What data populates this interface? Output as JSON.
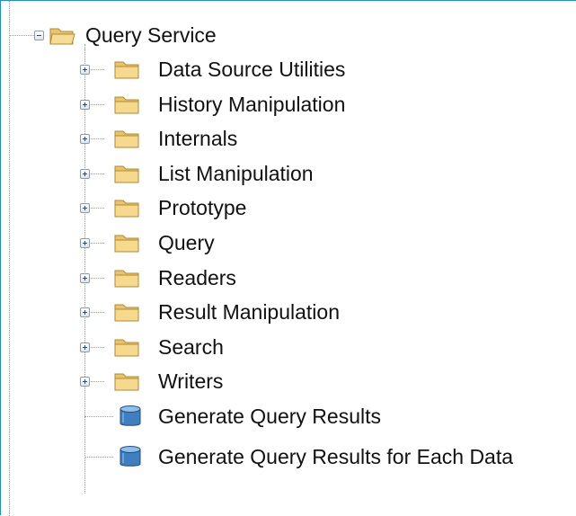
{
  "tree": {
    "root": {
      "label": "Query Service",
      "icon": "folder-open-icon",
      "expanded": true
    },
    "folders": [
      {
        "label": "Data Source Utilities",
        "icon": "folder-icon",
        "expanded": false
      },
      {
        "label": "History Manipulation",
        "icon": "folder-icon",
        "expanded": false
      },
      {
        "label": "Internals",
        "icon": "folder-icon",
        "expanded": false
      },
      {
        "label": "List Manipulation",
        "icon": "folder-icon",
        "expanded": false
      },
      {
        "label": "Prototype",
        "icon": "folder-icon",
        "expanded": false
      },
      {
        "label": "Query",
        "icon": "folder-icon",
        "expanded": false
      },
      {
        "label": "Readers",
        "icon": "folder-icon",
        "expanded": false
      },
      {
        "label": "Result Manipulation",
        "icon": "folder-icon",
        "expanded": false
      },
      {
        "label": "Search",
        "icon": "folder-icon",
        "expanded": false
      },
      {
        "label": "Writers",
        "icon": "folder-icon",
        "expanded": false
      }
    ],
    "items": [
      {
        "label": "Generate Query Results",
        "icon": "database-icon"
      },
      {
        "label": "Generate Query Results for Each Data",
        "icon": "database-icon"
      }
    ]
  },
  "colors": {
    "frame_border": "#1f8fd0",
    "folder_fill": "#f3d488",
    "folder_edge": "#b08a2e",
    "database_fill": "#3f7fc0"
  }
}
